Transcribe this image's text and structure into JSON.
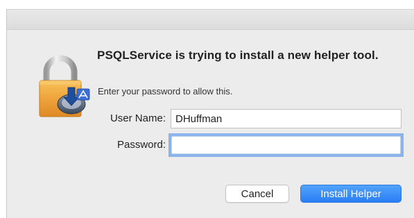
{
  "dialog": {
    "heading": "PSQLService is trying to install a new helper tool.",
    "prompt": "Enter your password to allow this.",
    "username_label": "User Name:",
    "username_value": "DHuffman",
    "password_label": "Password:",
    "password_value": "",
    "cancel_label": "Cancel",
    "install_label": "Install Helper"
  },
  "colors": {
    "window_bg": "#ececec",
    "accent_button": "#2f83f5",
    "focus_ring": "#8cb4ec",
    "lock_body": "#f0a53a",
    "lock_shackle": "#c8c8c8"
  }
}
